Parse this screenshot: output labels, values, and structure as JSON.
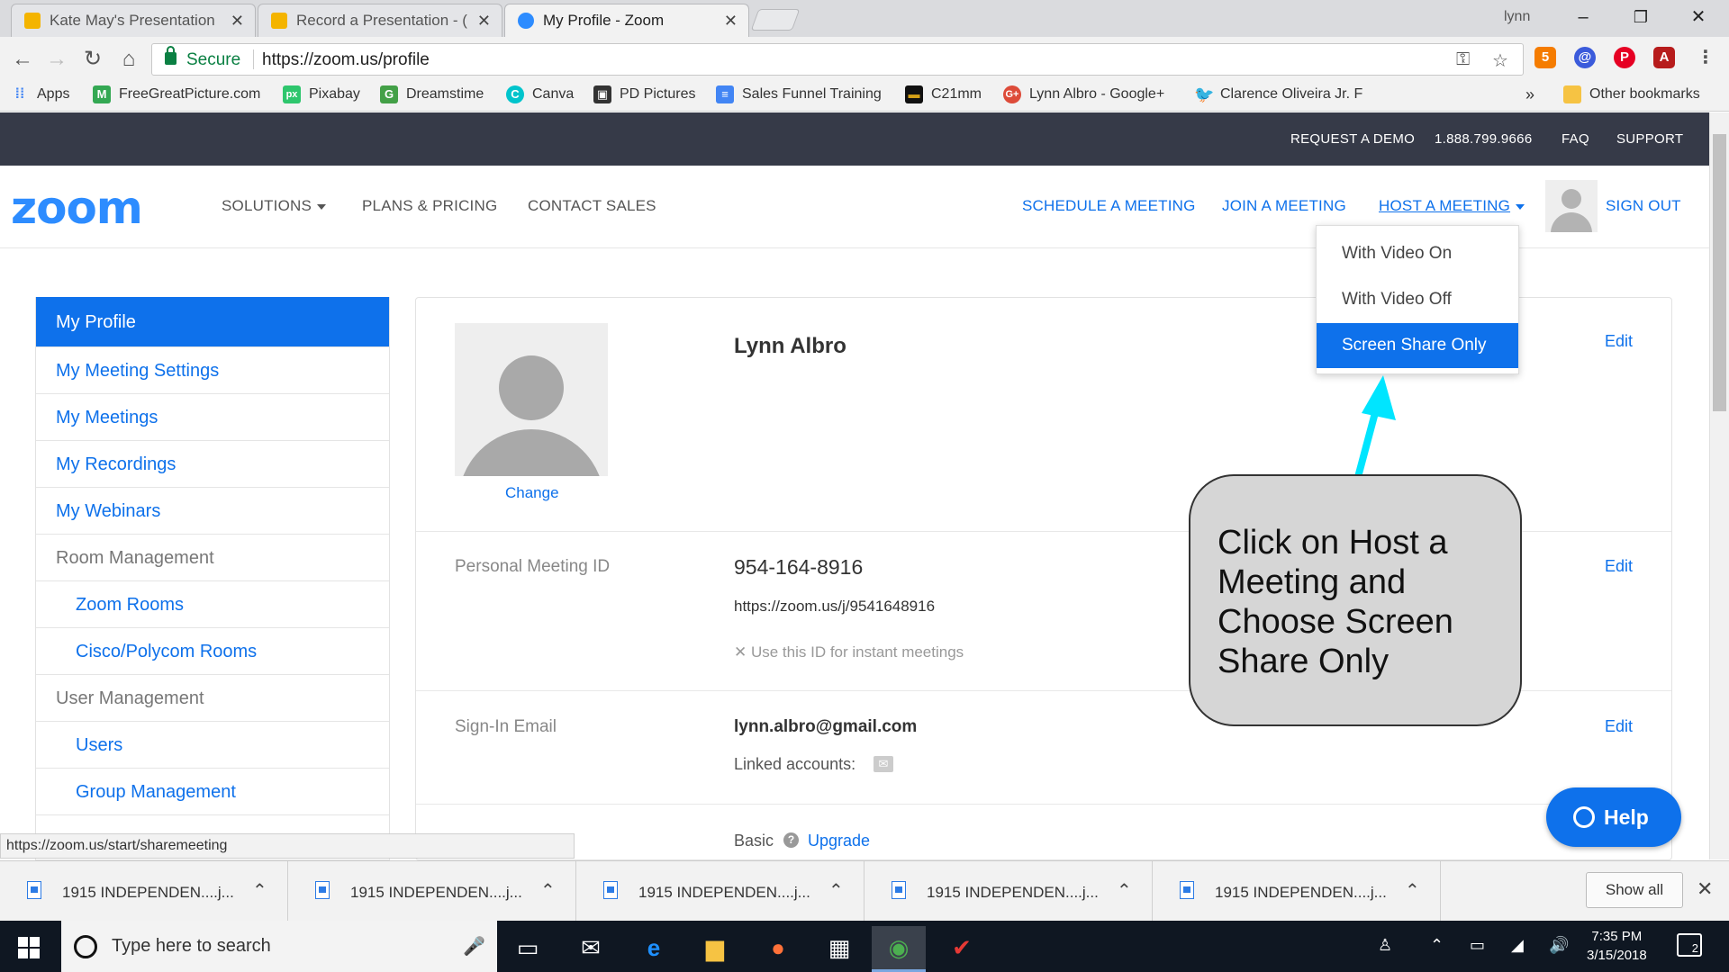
{
  "browser": {
    "tabs": [
      {
        "title": "Kate May's Presentation",
        "favicon_color": "#f4b400"
      },
      {
        "title": "Record a Presentation - (",
        "favicon_color": "#f4b400"
      },
      {
        "title": "My Profile - Zoom",
        "favicon_color": "#2d8cff"
      }
    ],
    "user": "lynn",
    "secure_label": "Secure",
    "url": "https://zoom.us/profile",
    "bookmarks": [
      {
        "label": "Apps",
        "icon": "apps-grid-icon"
      },
      {
        "label": "FreeGreatPicture.com",
        "icon": "m-icon"
      },
      {
        "label": "Pixabay",
        "icon": "px-icon"
      },
      {
        "label": "Dreamstime",
        "icon": "dreamstime-icon"
      },
      {
        "label": "Canva",
        "icon": "canva-icon"
      },
      {
        "label": "PD Pictures",
        "icon": "pd-icon"
      },
      {
        "label": "Sales Funnel Training",
        "icon": "doc-icon"
      },
      {
        "label": "C21mm",
        "icon": "c21-icon"
      },
      {
        "label": "Lynn Albro - Google+",
        "icon": "google-plus-icon"
      },
      {
        "label": "Clarence Oliveira Jr. F",
        "icon": "twitter-icon"
      }
    ],
    "more_bookmarks": "»",
    "other_bookmarks": "Other bookmarks",
    "status_url": "https://zoom.us/start/sharemeeting"
  },
  "zoom": {
    "topbar": {
      "request_demo": "REQUEST A DEMO",
      "phone": "1.888.799.9666",
      "faq": "FAQ",
      "support": "SUPPORT"
    },
    "header": {
      "logo": "zoom",
      "solutions": "SOLUTIONS",
      "plans": "PLANS & PRICING",
      "contact": "CONTACT SALES",
      "schedule": "SCHEDULE A MEETING",
      "join": "JOIN A MEETING",
      "host": "HOST A MEETING",
      "sign_out": "SIGN OUT"
    },
    "host_menu": [
      "With Video On",
      "With Video Off",
      "Screen Share Only"
    ],
    "sidebar": [
      {
        "label": "My Profile",
        "kind": "active"
      },
      {
        "label": "My Meeting Settings",
        "kind": "link"
      },
      {
        "label": "My Meetings",
        "kind": "link"
      },
      {
        "label": "My Recordings",
        "kind": "link"
      },
      {
        "label": "My Webinars",
        "kind": "link"
      },
      {
        "label": "Room Management",
        "kind": "section"
      },
      {
        "label": "Zoom Rooms",
        "kind": "sub"
      },
      {
        "label": "Cisco/Polycom Rooms",
        "kind": "sub"
      },
      {
        "label": "User Management",
        "kind": "section"
      },
      {
        "label": "Users",
        "kind": "sub"
      },
      {
        "label": "Group Management",
        "kind": "sub"
      }
    ],
    "profile": {
      "name": "Lynn Albro",
      "change": "Change",
      "edit": "Edit",
      "pmi_label": "Personal Meeting ID",
      "pmi": "954-164-8916",
      "pmi_url": "https://zoom.us/j/9541648916",
      "pmi_instant": "Use this ID for instant meetings",
      "email_label": "Sign-In Email",
      "email": "lynn.albro@gmail.com",
      "linked": "Linked accounts:",
      "plan": "Basic",
      "upgrade": "Upgrade"
    },
    "help": "Help"
  },
  "callout": "Click on Host a Meeting and Choose Screen Share Only",
  "downloads": {
    "items": [
      "1915 INDEPENDEN....j...",
      "1915 INDEPENDEN....j...",
      "1915 INDEPENDEN....j...",
      "1915 INDEPENDEN....j...",
      "1915 INDEPENDEN....j..."
    ],
    "show_all": "Show all"
  },
  "taskbar": {
    "search_placeholder": "Type here to search",
    "time": "7:35 PM",
    "date": "3/15/2018",
    "notifications": "2"
  },
  "colors": {
    "zoom_blue": "#0e71eb",
    "topbar": "#363a48",
    "arrow": "#00e5ff"
  }
}
